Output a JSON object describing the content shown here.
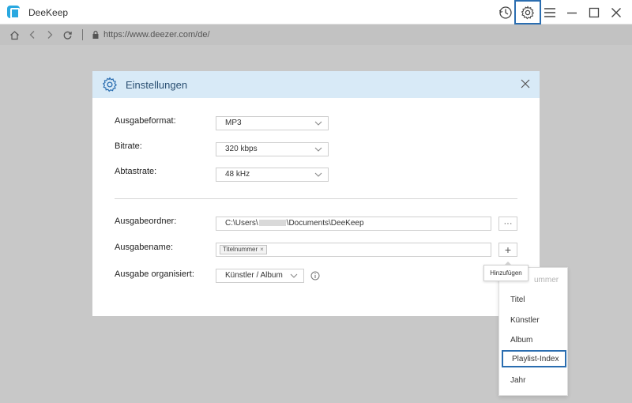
{
  "app": {
    "title": "DeeKeep"
  },
  "address": {
    "url": "https://www.deezer.com/de/"
  },
  "dialog": {
    "title": "Einstellungen",
    "fields": {
      "format_label": "Ausgabeformat:",
      "format_value": "MP3",
      "bitrate_label": "Bitrate:",
      "bitrate_value": "320 kbps",
      "samplerate_label": "Abtastrate:",
      "samplerate_value": "48 kHz",
      "folder_label": "Ausgabeordner:",
      "folder_prefix": "C:\\Users\\",
      "folder_suffix": "\\Documents\\DeeKeep",
      "folder_button": "···",
      "name_label": "Ausgabename:",
      "name_tag": "Titelnummer",
      "name_tag_remove": "×",
      "name_add": "+",
      "organize_label": "Ausgabe organisiert:",
      "organize_value": "Künstler / Album"
    }
  },
  "tooltip": {
    "text": "Hinzufügen"
  },
  "menu": {
    "partial_item": "ummer",
    "items": [
      "Titel",
      "Künstler",
      "Album",
      "Playlist-Index",
      "Jahr"
    ],
    "highlighted": "Playlist-Index"
  },
  "colors": {
    "accent": "#2a6db0",
    "header_bg": "#d8eaf7",
    "logo": "#29a8e0"
  }
}
